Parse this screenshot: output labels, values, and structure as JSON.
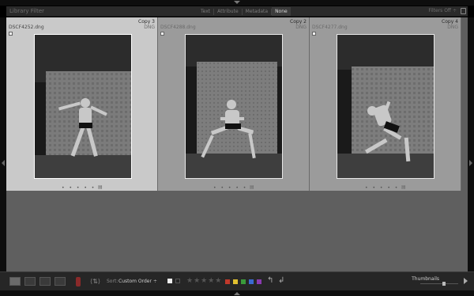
{
  "filter_bar": {
    "title": "Library Filter",
    "tabs": [
      "Text",
      "Attribute",
      "Metadata",
      "None"
    ],
    "active_tab": "None",
    "filters_status": "Filters Off ÷"
  },
  "cells": [
    {
      "copy": "Copy 3",
      "filename": "DSCF4252.dng",
      "ext": "DNG",
      "selected": true
    },
    {
      "copy": "Copy 2",
      "filename": "DSCF4288.dng",
      "ext": "DNG",
      "selected": false
    },
    {
      "copy": "Copy 4",
      "filename": "DSCF4277.dng",
      "ext": "DNG",
      "selected": false
    }
  ],
  "cell_dots": "• • • • •",
  "toolbar": {
    "sort_label": "Sort:",
    "sort_value": "Custom Order ÷",
    "stars": "★★★★★",
    "thumbnails_label": "Thumbnails",
    "label_colors": [
      "#c0392b",
      "#e0c030",
      "#3a9a3a",
      "#3a6ad0",
      "#8a3ab0"
    ]
  },
  "icons": {
    "grid_view": "grid-view-icon",
    "loupe_view": "loupe-view-icon",
    "compare_view": "compare-view-icon",
    "survey_view": "survey-view-icon",
    "painter": "spray-can-icon",
    "rotate_left": "rotate-left-icon",
    "rotate_right": "rotate-right-icon"
  }
}
